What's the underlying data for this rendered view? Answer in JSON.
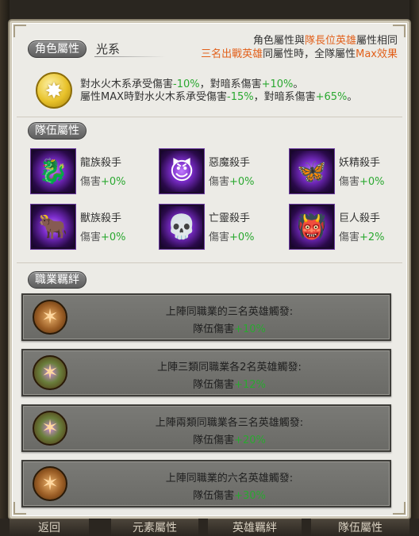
{
  "role_attribute": {
    "tag": "角色屬性",
    "value": "光系",
    "note_line1_a": "角色屬性與",
    "note_line1_hl": "隊長位英雄",
    "note_line1_b": "屬性相同",
    "note_line2_hl1": "三名出戰英雄",
    "note_line2_a": "同屬性時，全隊屬性",
    "note_line2_hl2": "Max效果",
    "icon": "light-element-icon",
    "line1_a": "對水火木系承受傷害",
    "line1_v1": "-10%",
    "line1_b": "，對暗系傷害",
    "line1_v2": "+10%",
    "line1_c": "。",
    "line2_a": "屬性MAX時對水火木系承受傷害",
    "line2_v1": "-15%",
    "line2_b": "，對暗系傷害",
    "line2_v2": "+65%",
    "line2_c": "。"
  },
  "team_attribute": {
    "tag": "隊伍屬性",
    "killers": [
      {
        "name": "龍族殺手",
        "dmg_label": "傷害",
        "value": "+0%",
        "icon": "dragon-icon"
      },
      {
        "name": "惡魔殺手",
        "dmg_label": "傷害",
        "value": "+0%",
        "icon": "demon-icon"
      },
      {
        "name": "妖精殺手",
        "dmg_label": "傷害",
        "value": "+0%",
        "icon": "fairy-icon"
      },
      {
        "name": "獸族殺手",
        "dmg_label": "傷害",
        "value": "+0%",
        "icon": "beast-icon"
      },
      {
        "name": "亡靈殺手",
        "dmg_label": "傷害",
        "value": "+0%",
        "icon": "undead-icon"
      },
      {
        "name": "巨人殺手",
        "dmg_label": "傷害",
        "value": "+2%",
        "icon": "giant-icon"
      }
    ]
  },
  "job_bond": {
    "tag": "職業羈絆",
    "bonds": [
      {
        "title": "上陣同職業的三名英雄觸發:",
        "effect_label": "隊伍傷害",
        "effect_value": "+10%",
        "icon": "bond-star-icon"
      },
      {
        "title": "上陣三類同職業各2名英雄觸發:",
        "effect_label": "隊伍傷害",
        "effect_value": "+12%",
        "icon": "bond-multi-icon"
      },
      {
        "title": "上陣兩類同職業各三名英雄觸發:",
        "effect_label": "隊伍傷害",
        "effect_value": "+20%",
        "icon": "bond-multi-icon"
      },
      {
        "title": "上陣同職業的六名英雄觸發:",
        "effect_label": "隊伍傷害",
        "effect_value": "+30%",
        "icon": "bond-star-icon"
      }
    ]
  },
  "tabs": [
    "返回",
    "元素屬性",
    "英雄羈絆",
    "隊伍屬性"
  ]
}
